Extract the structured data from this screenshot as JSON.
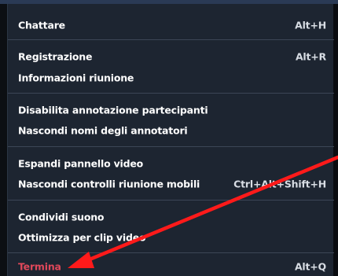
{
  "menu": {
    "items": [
      {
        "label": "Chattare",
        "shortcut": "Alt+H"
      },
      {
        "label": "Registrazione",
        "shortcut": "Alt+R"
      },
      {
        "label": "Informazioni riunione",
        "shortcut": ""
      },
      {
        "label": "Disabilita annotazione partecipanti",
        "shortcut": ""
      },
      {
        "label": "Nascondi nomi degli annotatori",
        "shortcut": ""
      },
      {
        "label": "Espandi pannello video",
        "shortcut": ""
      },
      {
        "label": "Nascondi controlli riunione mobili",
        "shortcut": "Ctrl+Alt+Shift+H"
      },
      {
        "label": "Condividi suono",
        "shortcut": ""
      },
      {
        "label": "Ottimizza per clip video",
        "shortcut": ""
      },
      {
        "label": "Termina",
        "shortcut": "Alt+Q"
      }
    ]
  },
  "annotation": {
    "arrow_color": "#ff1a1a",
    "danger_color": "#e0485a"
  }
}
